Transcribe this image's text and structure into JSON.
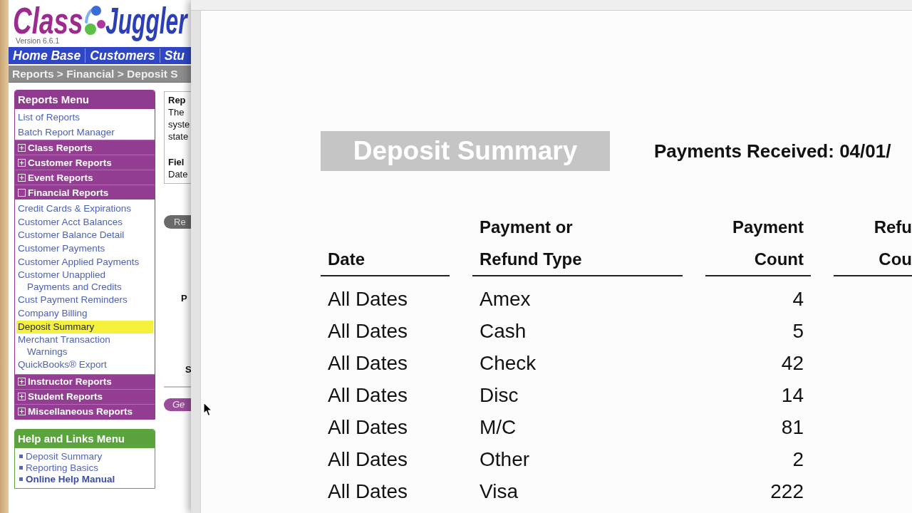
{
  "logo": {
    "first_word": "Class",
    "second_word": "Juggler",
    "version": "Version 6.6.1"
  },
  "nav_tabs": [
    "Home Base",
    "Customers",
    "Stu"
  ],
  "breadcrumb": "Reports > Financial > Deposit S",
  "reports_menu": {
    "title": "Reports Menu",
    "items": [
      {
        "kind": "link",
        "label": "List of Reports",
        "selected": false
      },
      {
        "kind": "link",
        "label": "Batch Report Manager",
        "selected": false
      },
      {
        "kind": "section",
        "label": "Class Reports",
        "expanded": false
      },
      {
        "kind": "section",
        "label": "Customer Reports",
        "expanded": false
      },
      {
        "kind": "section",
        "label": "Event Reports",
        "expanded": false
      },
      {
        "kind": "section",
        "label": "Financial Reports",
        "expanded": true,
        "children": [
          {
            "label": "Credit Cards & Expirations",
            "selected": false
          },
          {
            "label": "Customer Acct Balances",
            "selected": false
          },
          {
            "label": "Customer Balance Detail",
            "selected": false
          },
          {
            "label": "Customer Payments",
            "selected": false
          },
          {
            "label": "Customer Applied Payments",
            "selected": false
          },
          {
            "label": "Customer Unapplied Payments and Credits",
            "selected": false
          },
          {
            "label": "Cust Payment Reminders",
            "selected": false
          },
          {
            "label": "Company Billing",
            "selected": false
          },
          {
            "label": "Deposit Summary",
            "selected": true
          },
          {
            "label": "Merchant Transaction Warnings",
            "selected": false
          },
          {
            "label": "QuickBooks® Export",
            "selected": false
          }
        ]
      },
      {
        "kind": "section",
        "label": "Instructor Reports",
        "expanded": false
      },
      {
        "kind": "section",
        "label": "Student Reports",
        "expanded": false
      },
      {
        "kind": "section",
        "label": "Miscellaneous Reports",
        "expanded": false
      }
    ]
  },
  "help_menu": {
    "title": "Help and Links Menu",
    "links": [
      {
        "label": "Deposit Summary",
        "emphasized": false
      },
      {
        "label": "Reporting Basics",
        "emphasized": false
      },
      {
        "label": "Online Help Manual",
        "emphasized": true
      }
    ]
  },
  "report_panel": {
    "title": "Rep",
    "description_lines": [
      "The",
      "syste",
      "state"
    ],
    "field_label": "Fiel",
    "field_value": "Date"
  },
  "report_button": "Re",
  "form_labels": [
    "P",
    "S"
  ],
  "generate_button": "Ge",
  "document": {
    "title": "Deposit Summary",
    "date_range": "Payments Received: 04/01/",
    "columns": [
      {
        "lines": [
          "Date"
        ]
      },
      {
        "lines": [
          "Payment or",
          "Refund Type"
        ]
      },
      {
        "lines": [
          "Payment",
          "Count"
        ]
      },
      {
        "lines": [
          "Refu",
          "Cou"
        ]
      }
    ],
    "rows": [
      {
        "cells": [
          "All Dates",
          "Amex",
          "4"
        ]
      },
      {
        "cells": [
          "All Dates",
          "Cash",
          "5"
        ]
      },
      {
        "cells": [
          "All Dates",
          "Check",
          "42"
        ]
      },
      {
        "cells": [
          "All Dates",
          "Disc",
          "14"
        ]
      },
      {
        "cells": [
          "All Dates",
          "M/C",
          "81"
        ]
      },
      {
        "cells": [
          "All Dates",
          "Other",
          "2"
        ]
      },
      {
        "cells": [
          "All Dates",
          "Visa",
          "222"
        ]
      }
    ]
  }
}
